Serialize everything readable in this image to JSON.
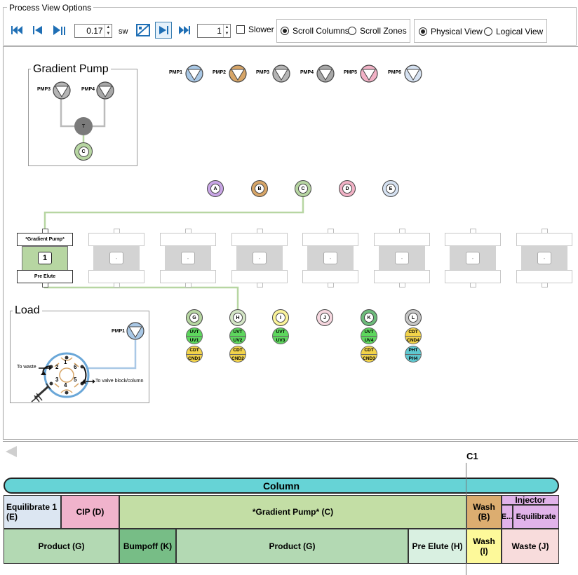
{
  "options": {
    "title": "Process View Options",
    "speed_value": "0.17",
    "speed_unit": "sw",
    "step_value": "1",
    "slower_label": "Slower",
    "scroll_columns_label": "Scroll Columns",
    "scroll_zones_label": "Scroll Zones",
    "physical_view_label": "Physical View",
    "logical_view_label": "Logical View"
  },
  "gradient_pump": {
    "title": "Gradient Pump",
    "pump_a": "PMP3",
    "pump_b": "PMP4",
    "tee": "T",
    "outlet": "C"
  },
  "pumps": [
    {
      "label": "PMP1",
      "color": "#a9c8e6"
    },
    {
      "label": "PMP2",
      "color": "#d7a567"
    },
    {
      "label": "PMP3",
      "color": "#b5b5b5"
    },
    {
      "label": "PMP4",
      "color": "#a8a8a8"
    },
    {
      "label": "PMP5",
      "color": "#f2b2c6"
    },
    {
      "label": "PMP6",
      "color": "#d6e2f2"
    }
  ],
  "inlets": [
    {
      "label": "A",
      "color": "#c9a6e6"
    },
    {
      "label": "B",
      "color": "#d7a567"
    },
    {
      "label": "C",
      "color": "#b7d6a2"
    },
    {
      "label": "D",
      "color": "#f2b2c6"
    },
    {
      "label": "E",
      "color": "#d6e2f2"
    }
  ],
  "column_1": {
    "top_label": "*Gradient Pump*",
    "number": "1",
    "bottom_label": "Pre Elute"
  },
  "empty_column_label": "-",
  "outlets": [
    {
      "label": "G",
      "color": "#b7d6a2",
      "sensors": [
        {
          "a": "UVT",
          "b": "UV1",
          "color": "#5dd65d"
        },
        {
          "a": "CDT",
          "b": "CND1",
          "color": "#f2d34a"
        }
      ]
    },
    {
      "label": "H",
      "color": "#d4e6c6",
      "sensors": [
        {
          "a": "UVT",
          "b": "UV2",
          "color": "#5dd65d"
        },
        {
          "a": "CDT",
          "b": "CND2",
          "color": "#f2d34a"
        }
      ]
    },
    {
      "label": "I",
      "color": "#fbf49a",
      "sensors": [
        {
          "a": "UVT",
          "b": "UV3",
          "color": "#5dd65d"
        }
      ]
    },
    {
      "label": "J",
      "color": "#f6d7df",
      "sensors": []
    },
    {
      "label": "K",
      "color": "#6dbb7b",
      "sensors": [
        {
          "a": "UVT",
          "b": "UV4",
          "color": "#5dd65d"
        },
        {
          "a": "CDT",
          "b": "CND3",
          "color": "#f2d34a"
        }
      ]
    },
    {
      "label": "L",
      "color": "#c7c7c7",
      "sensors": [
        {
          "a": "CDT",
          "b": "CND4",
          "color": "#f2d34a"
        },
        {
          "a": "PHT",
          "b": "PH4",
          "color": "#5ec7cf"
        }
      ]
    }
  ],
  "load": {
    "title": "Load",
    "pump": "PMP1",
    "to_waste": "To waste",
    "to_valve": "To valve block/column",
    "ports": [
      "1",
      "2",
      "3",
      "4",
      "5",
      "6"
    ]
  },
  "timeline": {
    "marker": "C1",
    "column_label": "Column",
    "column_color": "#66d3d6",
    "row1": [
      {
        "label": "Equilibrate 1\n(E)",
        "color": "#dce6f2"
      },
      {
        "label": "CIP (D)",
        "color": "#f0b3cc"
      },
      {
        "label": "*Gradient Pump* (C)",
        "color": "#c3dea5"
      },
      {
        "label": "Wash\n(B)",
        "color": "#dcad70"
      },
      {
        "label": "Injector",
        "color": "#e1b3ea"
      },
      {
        "label": "E...",
        "color": "#e1b3ea"
      },
      {
        "label": "Equilibrate",
        "color": "#e1b3ea"
      }
    ],
    "row2": [
      {
        "label": "Product (G)",
        "color": "#b3d9b3"
      },
      {
        "label": "Bumpoff (K)",
        "color": "#77bd86"
      },
      {
        "label": "Product (G)",
        "color": "#b3d9b3"
      },
      {
        "label": "Pre Elute (H)",
        "color": "#d9f0e1"
      },
      {
        "label": "Wash\n(I)",
        "color": "#fdf99a"
      },
      {
        "label": "Waste (J)",
        "color": "#f8dcdc"
      }
    ]
  }
}
